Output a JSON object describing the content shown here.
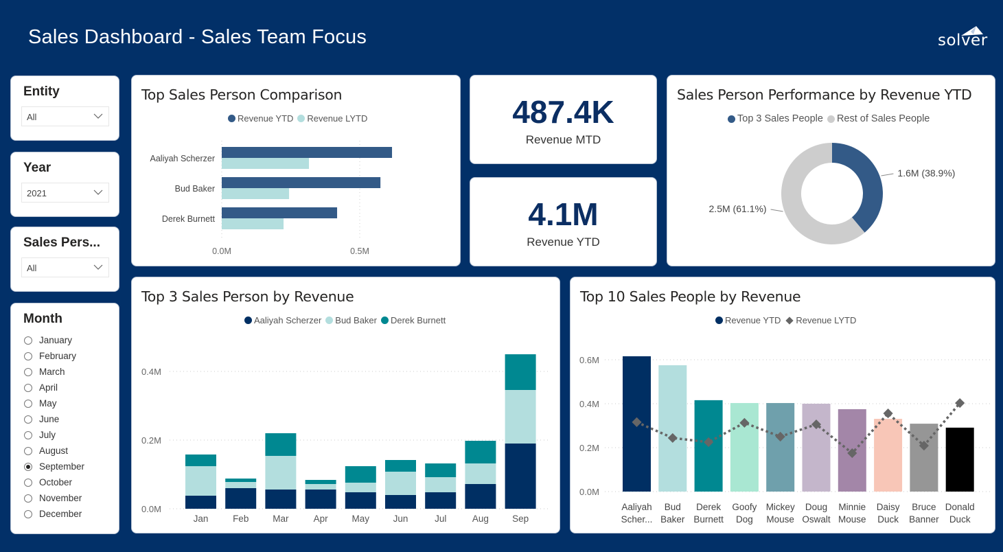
{
  "header": {
    "title": "Sales Dashboard - Sales Team Focus",
    "logo_text": "solver"
  },
  "colors": {
    "background": "#023068",
    "navy": "#002f63",
    "ytd_blue": "#335a87",
    "light_teal": "#b3dede",
    "teal": "#008891",
    "donut_gray": "#cdcdcd",
    "line_gray": "#666666"
  },
  "slicers": {
    "entity": {
      "title": "Entity",
      "value": "All"
    },
    "year": {
      "title": "Year",
      "value": "2021"
    },
    "sales_person": {
      "title": "Sales Pers...",
      "value": "All"
    },
    "month": {
      "title": "Month",
      "options": [
        "January",
        "February",
        "March",
        "April",
        "May",
        "June",
        "July",
        "August",
        "September",
        "October",
        "November",
        "December"
      ],
      "selected": "September"
    }
  },
  "kpis": {
    "mtd": {
      "value": "487.4K",
      "label": "Revenue MTD"
    },
    "ytd": {
      "value": "4.1M",
      "label": "Revenue YTD"
    }
  },
  "chart_data": [
    {
      "id": "comparison",
      "type": "bar",
      "orientation": "horizontal",
      "title": "Top Sales Person Comparison",
      "categories": [
        "Aaliyah Scherzer",
        "Bud Baker",
        "Derek Burnett"
      ],
      "series": [
        {
          "name": "Revenue YTD",
          "color": "#335a87",
          "values": [
            0.617,
            0.575,
            0.418
          ]
        },
        {
          "name": "Revenue LYTD",
          "color": "#b3dede",
          "values": [
            0.316,
            0.244,
            0.224
          ]
        }
      ],
      "xticks": [
        "0.0M",
        "0.5M"
      ],
      "xtick_values": [
        0,
        0.5
      ],
      "xlim": [
        0,
        0.85
      ],
      "unit": "M",
      "legend": "top-center"
    },
    {
      "id": "donut",
      "type": "pie",
      "title": "Sales Person Performance by Revenue YTD",
      "slices": [
        {
          "name": "Top 3 Sales People",
          "value": 1.6,
          "percent": 38.9,
          "label": "1.6M (38.9%)",
          "color": "#335a87"
        },
        {
          "name": "Rest of Sales People",
          "value": 2.5,
          "percent": 61.1,
          "label": "2.5M (61.1%)",
          "color": "#cdcdcd"
        }
      ],
      "legend": "top-center"
    },
    {
      "id": "stacked",
      "type": "bar",
      "stacked": true,
      "title": "Top 3 Sales Person by Revenue",
      "categories": [
        "Jan",
        "Feb",
        "Mar",
        "Apr",
        "May",
        "Jun",
        "Jul",
        "Aug",
        "Sep"
      ],
      "series": [
        {
          "name": "Aaliyah Scherzer",
          "color": "#002f63",
          "values": [
            0.038,
            0.06,
            0.056,
            0.056,
            0.048,
            0.04,
            0.048,
            0.072,
            0.19
          ]
        },
        {
          "name": "Bud Baker",
          "color": "#b3dede",
          "values": [
            0.086,
            0.018,
            0.098,
            0.016,
            0.028,
            0.068,
            0.044,
            0.06,
            0.156
          ]
        },
        {
          "name": "Derek Burnett",
          "color": "#008891",
          "values": [
            0.034,
            0.01,
            0.066,
            0.012,
            0.048,
            0.034,
            0.04,
            0.066,
            0.104
          ]
        }
      ],
      "yticks": [
        "0.0M",
        "0.2M",
        "0.4M"
      ],
      "ytick_values": [
        0,
        0.2,
        0.4
      ],
      "ylim": [
        0,
        0.45
      ],
      "grid": true,
      "legend": "top-center"
    },
    {
      "id": "top10",
      "type": "bar",
      "combo_line": true,
      "title": "Top 10 Sales People by Revenue",
      "categories": [
        [
          "Aaliyah",
          "Scher..."
        ],
        [
          "Bud",
          "Baker"
        ],
        [
          "Derek",
          "Burnett"
        ],
        [
          "Goofy",
          "Dog"
        ],
        [
          "Mickey",
          "Mouse"
        ],
        [
          "Doug",
          "Oswalt"
        ],
        [
          "Minnie",
          "Mouse"
        ],
        [
          "Daisy",
          "Duck"
        ],
        [
          "Bruce",
          "Banner"
        ],
        [
          "Donald",
          "Duck"
        ]
      ],
      "bar_colors": [
        "#002f63",
        "#b3dede",
        "#008891",
        "#a9e7d2",
        "#6fa0ac",
        "#c4b6cb",
        "#a386a8",
        "#f8c6b7",
        "#969696",
        "#000000"
      ],
      "series": [
        {
          "name": "Revenue YTD",
          "type": "bar",
          "color": "#002f63",
          "values": [
            0.616,
            0.575,
            0.416,
            0.403,
            0.403,
            0.4,
            0.375,
            0.331,
            0.309,
            0.291
          ]
        },
        {
          "name": "Revenue LYTD",
          "type": "line",
          "marker": "diamond",
          "dashed": true,
          "color": "#666666",
          "values": [
            0.316,
            0.244,
            0.225,
            0.313,
            0.25,
            0.306,
            0.175,
            0.356,
            0.209,
            0.403
          ]
        }
      ],
      "yticks": [
        "0.0M",
        "0.2M",
        "0.4M",
        "0.6M"
      ],
      "ytick_values": [
        0,
        0.2,
        0.4,
        0.6
      ],
      "ylim": [
        0,
        0.6
      ],
      "grid": true,
      "legend": "top-center"
    }
  ]
}
